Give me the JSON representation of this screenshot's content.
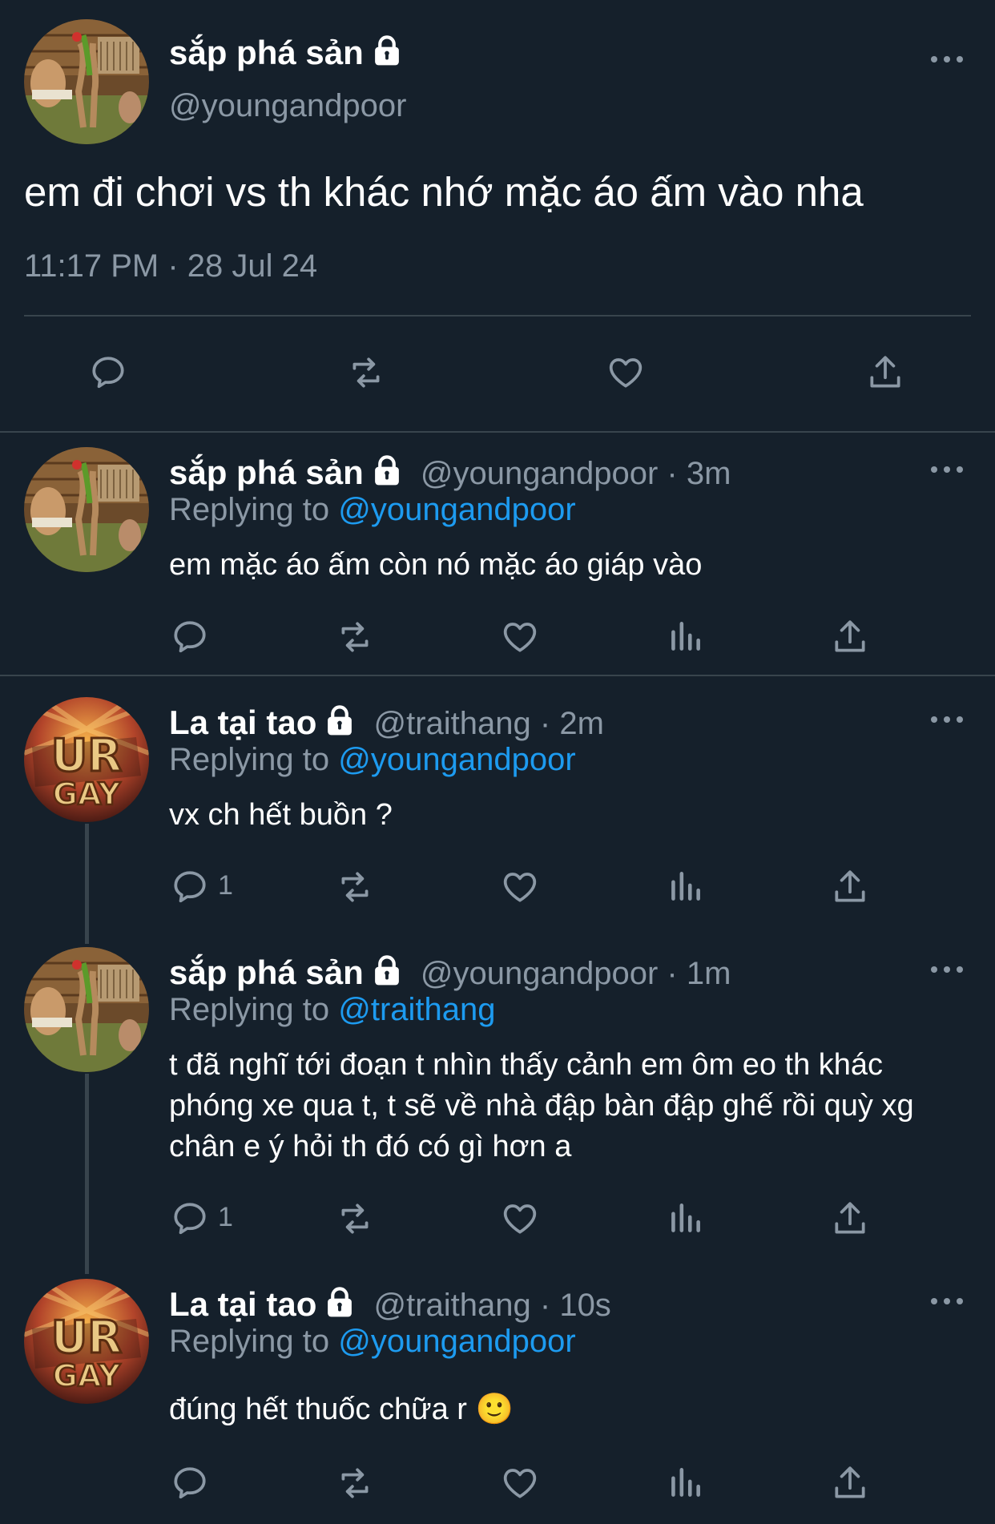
{
  "main_tweet": {
    "name": "sắp phá sản",
    "handle": "@youngandpoor",
    "text": "em đi chơi vs th khác nhớ mặc áo ấm vào nha",
    "timestamp": "11:17 PM · 28 Jul 24"
  },
  "replies": [
    {
      "name": "sắp phá sản",
      "handle_time": "@youngandpoor · 3m",
      "replying_label": "Replying to",
      "replying_to": "@youngandpoor",
      "text": "em mặc áo ấm còn nó mặc áo giáp vào",
      "reply_count": ""
    },
    {
      "name": "La tại tao",
      "handle_time": "@traithang · 2m",
      "replying_label": "Replying to",
      "replying_to": "@youngandpoor",
      "text": "vx ch hết buồn ?",
      "reply_count": "1"
    },
    {
      "name": "sắp phá sản",
      "handle_time": "@youngandpoor · 1m",
      "replying_label": "Replying to",
      "replying_to": "@traithang",
      "text": "t đã nghĩ tới đoạn t nhìn thấy cảnh em ôm eo th khác phóng xe qua t, t sẽ về nhà đập bàn đập ghế rồi quỳ xg chân e ý hỏi th đó có gì hơn a",
      "reply_count": "1"
    },
    {
      "name": "La tại tao",
      "handle_time": "@traithang · 10s",
      "replying_label": "Replying to",
      "replying_to": "@youngandpoor",
      "text": "đúng hết thuốc chữa r 🙂",
      "reply_count": ""
    }
  ],
  "avatars": {
    "youngandpoor": "shrek-swamp-scene",
    "traithang_text_top": "UR",
    "traithang_text_bottom": "GAY"
  },
  "icons": [
    "lock-icon",
    "more-icon",
    "reply-icon",
    "retweet-icon",
    "like-icon",
    "analytics-icon",
    "share-icon"
  ],
  "colors": {
    "background": "#15202b",
    "link": "#1d9bf0",
    "muted": "#8b98a5",
    "divider": "#38444d"
  }
}
